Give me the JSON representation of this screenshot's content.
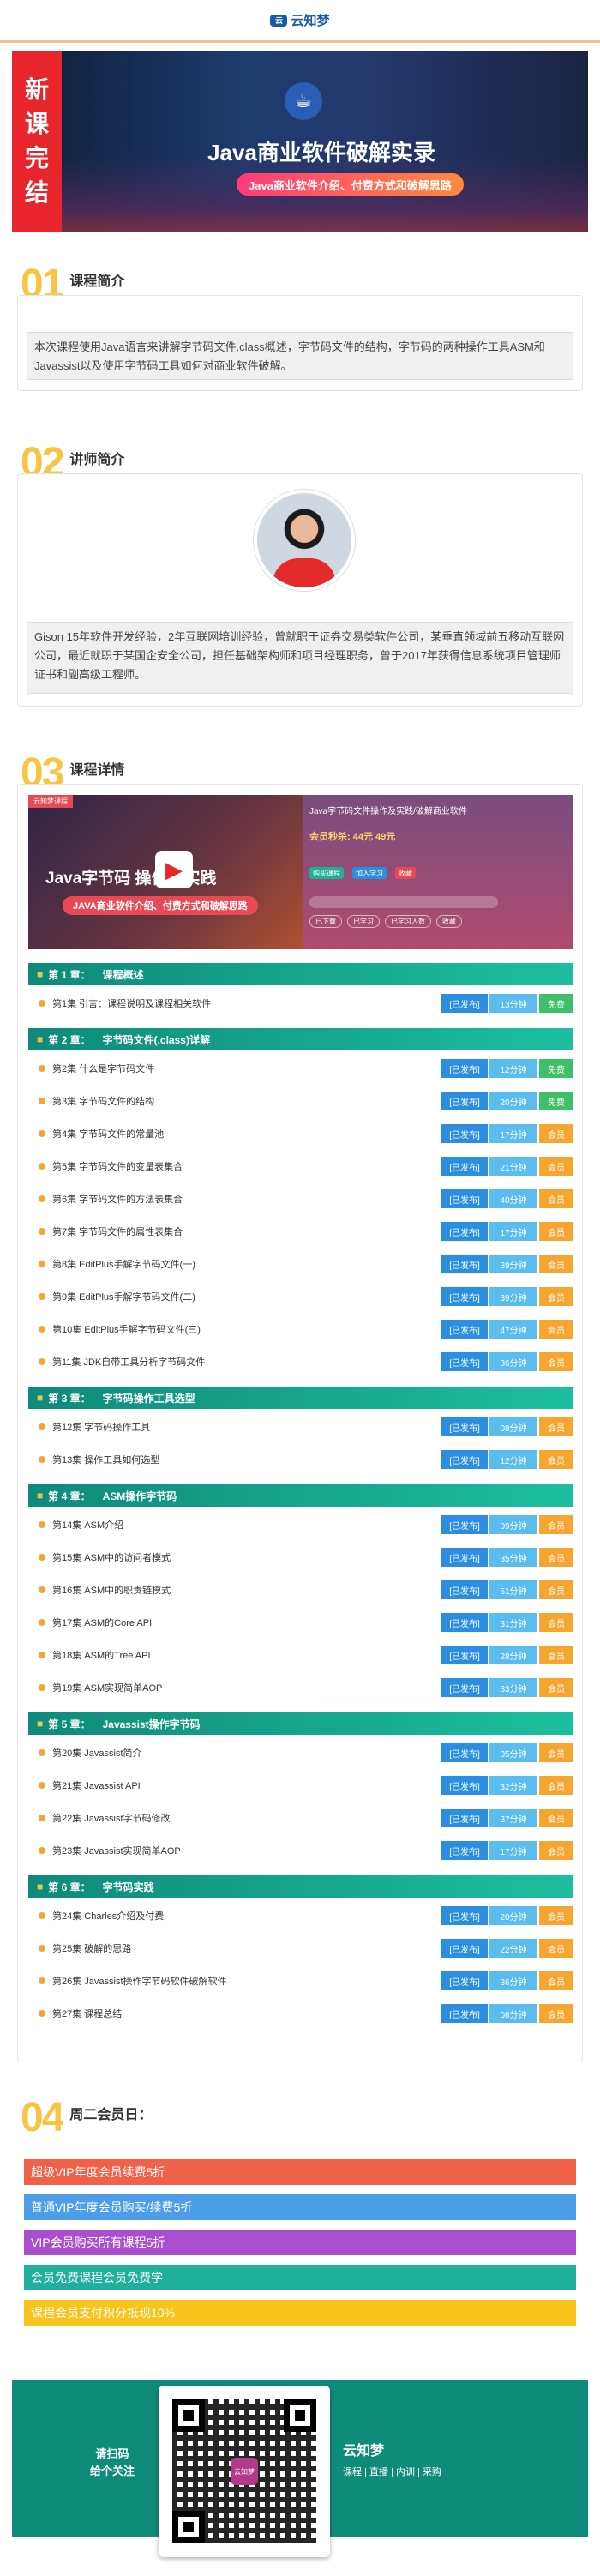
{
  "header": {
    "logo_text": "云知梦",
    "logo_mark": "云"
  },
  "banner": {
    "badge_chars": [
      "新",
      "课",
      "完",
      "结"
    ],
    "cup_icon": "coffee-cup-icon",
    "title": "Java商业软件破解实录",
    "subtitle": "Java商业软件介绍、付费方式和破解思路"
  },
  "section1": {
    "num": "01",
    "title": "课程简介",
    "text": "本次课程使用Java语言来讲解字节码文件.class概述，字节码文件的结构，字节码的两种操作工具ASM和Javassist以及使用字节码工具如何对商业软件破解。"
  },
  "section2": {
    "num": "02",
    "title": "讲师简介",
    "text": "Gison 15年软件开发经验，2年互联网培训经验，曾就职于证券交易类软件公司，某垂直领域前五移动互联网公司，最近就职于某国企安全公司，担任基础架构师和项目经理职务，曾于2017年获得信息系统项目管理师证书和副高级工程师。"
  },
  "section3": {
    "num": "03",
    "title": "课程详情",
    "promo": {
      "corner": "云知梦课程",
      "title": "Java字节码 操作及实践",
      "subtitle": "JAVA商业软件介绍、付费方式和破解思路",
      "right_title": "Java字节码文件操作及实践/破解商业软件",
      "price": "会员秒杀: 44元 49元",
      "chip1": "购买课程",
      "chip2": "加入学习",
      "chip3": "收藏",
      "tags": [
        "已下载",
        "已学习",
        "已学习人数",
        "收藏"
      ]
    },
    "chapters": [
      {
        "label": "第 1 章：",
        "title": "课程概述",
        "lessons": [
          {
            "title": "第1集 引言：课程说明及课程相关软件",
            "status": "[已发布]",
            "duration": "13分钟",
            "price": "免费"
          }
        ]
      },
      {
        "label": "第 2 章：",
        "title": "字节码文件(.class)详解",
        "lessons": [
          {
            "title": "第2集 什么是字节码文件",
            "status": "[已发布]",
            "duration": "12分钟",
            "price": "免费"
          },
          {
            "title": "第3集 字节码文件的结构",
            "status": "[已发布]",
            "duration": "20分钟",
            "price": "免费"
          },
          {
            "title": "第4集 字节码文件的常量池",
            "status": "[已发布]",
            "duration": "17分钟",
            "price": "会员"
          },
          {
            "title": "第5集 字节码文件的变量表集合",
            "status": "[已发布]",
            "duration": "21分钟",
            "price": "会员"
          },
          {
            "title": "第6集 字节码文件的方法表集合",
            "status": "[已发布]",
            "duration": "40分钟",
            "price": "会员"
          },
          {
            "title": "第7集 字节码文件的属性表集合",
            "status": "[已发布]",
            "duration": "17分钟",
            "price": "会员"
          },
          {
            "title": "第8集 EditPlus手解字节码文件(一)",
            "status": "[已发布]",
            "duration": "39分钟",
            "price": "会员"
          },
          {
            "title": "第9集 EditPlus手解字节码文件(二)",
            "status": "[已发布]",
            "duration": "39分钟",
            "price": "会员"
          },
          {
            "title": "第10集 EditPlus手解字节码文件(三)",
            "status": "[已发布]",
            "duration": "47分钟",
            "price": "会员"
          },
          {
            "title": "第11集 JDK自带工具分析字节码文件",
            "status": "[已发布]",
            "duration": "36分钟",
            "price": "会员"
          }
        ]
      },
      {
        "label": "第 3 章：",
        "title": "字节码操作工具选型",
        "lessons": [
          {
            "title": "第12集 字节码操作工具",
            "status": "[已发布]",
            "duration": "08分钟",
            "price": "会员"
          },
          {
            "title": "第13集 操作工具如何选型",
            "status": "[已发布]",
            "duration": "12分钟",
            "price": "会员"
          }
        ]
      },
      {
        "label": "第 4 章：",
        "title": "ASM操作字节码",
        "lessons": [
          {
            "title": "第14集 ASM介绍",
            "status": "[已发布]",
            "duration": "09分钟",
            "price": "会员"
          },
          {
            "title": "第15集 ASM中的访问者模式",
            "status": "[已发布]",
            "duration": "35分钟",
            "price": "会员"
          },
          {
            "title": "第16集 ASM中的职责链模式",
            "status": "[已发布]",
            "duration": "51分钟",
            "price": "会员"
          },
          {
            "title": "第17集 ASM的Core API",
            "status": "[已发布]",
            "duration": "31分钟",
            "price": "会员"
          },
          {
            "title": "第18集 ASM的Tree API",
            "status": "[已发布]",
            "duration": "28分钟",
            "price": "会员"
          },
          {
            "title": "第19集 ASM实现简单AOP",
            "status": "[已发布]",
            "duration": "33分钟",
            "price": "会员"
          }
        ]
      },
      {
        "label": "第 5 章：",
        "title": "Javassist操作字节码",
        "lessons": [
          {
            "title": "第20集 Javassist简介",
            "status": "[已发布]",
            "duration": "05分钟",
            "price": "会员"
          },
          {
            "title": "第21集 Javassist API",
            "status": "[已发布]",
            "duration": "32分钟",
            "price": "会员"
          },
          {
            "title": "第22集 Javassist字节码修改",
            "status": "[已发布]",
            "duration": "37分钟",
            "price": "会员"
          },
          {
            "title": "第23集 Javassist实现简单AOP",
            "status": "[已发布]",
            "duration": "17分钟",
            "price": "会员"
          }
        ]
      },
      {
        "label": "第 6 章：",
        "title": "字节码实践",
        "lessons": [
          {
            "title": "第24集 Charles介绍及付费",
            "status": "[已发布]",
            "duration": "20分钟",
            "price": "会员"
          },
          {
            "title": "第25集 破解的思路",
            "status": "[已发布]",
            "duration": "22分钟",
            "price": "会员"
          },
          {
            "title": "第26集 Javassist操作字节码软件破解软件",
            "status": "[已发布]",
            "duration": "36分钟",
            "price": "会员"
          },
          {
            "title": "第27集 课程总结",
            "status": "[已发布]",
            "duration": "08分钟",
            "price": "会员"
          }
        ]
      }
    ]
  },
  "section4": {
    "num": "04",
    "title": "周二会员日：",
    "items": [
      {
        "text": "超级VIP年度会员续费5折",
        "color": "#f0614a"
      },
      {
        "text": "普通VIP年度会员购买/续费5折",
        "color": "#4d9ee8"
      },
      {
        "text": "VIP会员购买所有课程5折",
        "color": "#a94fce"
      },
      {
        "text": "会员免费课程会员免费学",
        "color": "#1eb09a"
      },
      {
        "text": "课程会员支付积分抵现10%",
        "color": "#f8c31a"
      }
    ]
  },
  "footer": {
    "scan_line1": "请扫码",
    "scan_line2": "给个关注",
    "qr_logo": "云知梦",
    "brand_name": "云知梦",
    "brand_links": "课程 | 直播 | 内训 | 采购"
  },
  "colors": {
    "accent": "#f7c443",
    "teal": "#0e8a7a",
    "free": "#3fbf6a",
    "member": "#f7a531",
    "published": "#2c8ee0",
    "duration": "#5bbcf0"
  }
}
